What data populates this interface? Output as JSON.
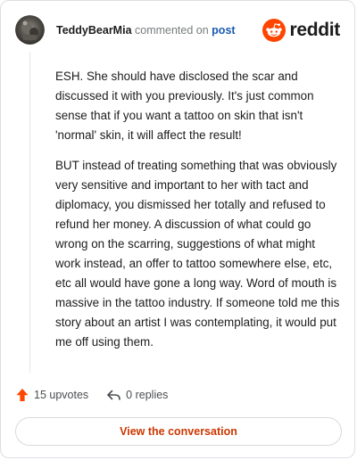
{
  "header": {
    "username": "TeddyBearMia",
    "action_text": "commented on",
    "link_text": "post",
    "brand_name": "reddit"
  },
  "comment": {
    "paragraphs": [
      "ESH. She should have disclosed the scar and discussed it with you previously. It's just common sense that if you want a tattoo on skin that isn't 'normal' skin, it will affect the result!",
      "BUT instead of treating something that was obviously very sensitive and important to her with tact and diplomacy, you dismissed her totally and refused to refund her money. A discussion of what could go wrong on the scarring, suggestions of what might work instead, an offer to tattoo somewhere else, etc, etc all would have gone a long way. Word of mouth is massive in the tattoo industry. If someone told me this story about an artist I was contemplating, it would put me off using them."
    ]
  },
  "actions": {
    "upvotes": "15 upvotes",
    "replies": "0 replies"
  },
  "footer": {
    "view_button": "View the conversation"
  },
  "colors": {
    "brand_orange": "#ff4500",
    "upvote_orange": "#ff4500",
    "link_blue": "#1b5bb0",
    "button_text": "#cc3700"
  },
  "icons": {
    "avatar": "user-avatar",
    "brand": "reddit-alien-icon",
    "upvote": "upvote-arrow-icon",
    "reply": "reply-arrow-icon"
  }
}
